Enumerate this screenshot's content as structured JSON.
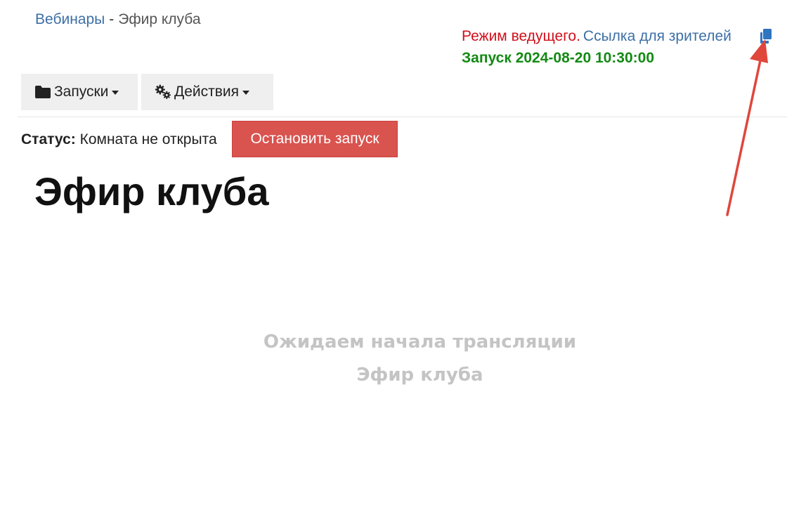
{
  "breadcrumb": {
    "link": "Вебинары",
    "separator": "-",
    "current": "Эфир клуба"
  },
  "header_info": {
    "host_mode": "Режим ведущего.",
    "viewers_link": "Ссылка для зрителей",
    "launch_time": "Запуск 2024-08-20 10:30:00",
    "copy_icon": "copy-icon"
  },
  "toolbar": {
    "launches_label": "Запуски",
    "actions_label": "Действия"
  },
  "status": {
    "label": "Статус:",
    "value": "Комната не открыта"
  },
  "stop_button_label": "Остановить запуск",
  "page_title": "Эфир клуба",
  "waiting": {
    "line1": "Ожидаем начала трансляции",
    "line2": "Эфир клуба"
  },
  "colors": {
    "link": "#3d6fa6",
    "host_mode": "#d0101b",
    "launch_time": "#138a14",
    "stop_button": "#d9534f",
    "annotation_arrow": "#e0463c"
  }
}
